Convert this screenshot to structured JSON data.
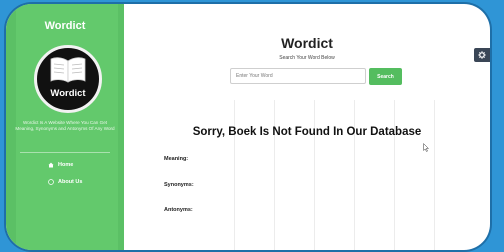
{
  "sidebar": {
    "brand": "Wordict",
    "logo_text": "Wordict",
    "description": "Wordict Is A Website Where You Can Get Meaning, Synonyms and Antonyms Of Any Word",
    "nav": [
      {
        "label": "Home",
        "icon": "home-icon"
      },
      {
        "label": "About Us",
        "icon": "info-icon"
      }
    ]
  },
  "main": {
    "title": "Wordict",
    "subtitle": "Search Your Word Below",
    "search": {
      "placeholder": "Enter Your Word",
      "button": "Search"
    },
    "message": "Sorry, Boek Is Not Found In Our Database",
    "fields": {
      "meaning": "Meaning:",
      "synonyms": "Synonyms:",
      "antonyms": "Antonyms:"
    }
  },
  "colors": {
    "accent_green": "#5bc065",
    "background_blue": "#2f95d6",
    "settings_button": "#3a4656"
  }
}
